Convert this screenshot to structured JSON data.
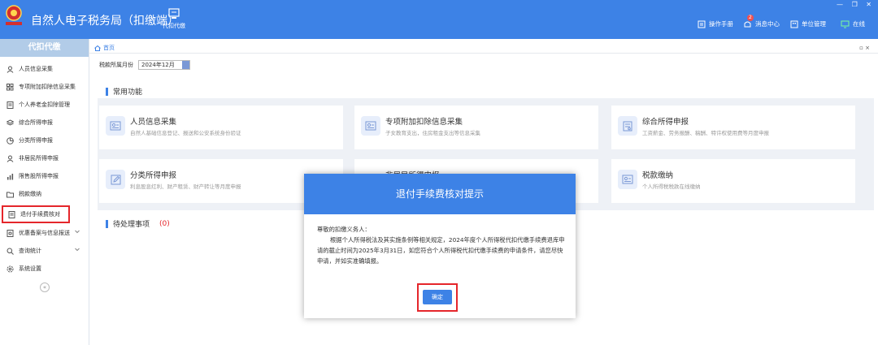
{
  "header": {
    "title": "自然人电子税务局（扣缴端）",
    "logo_label": "中国税务",
    "tab_label": "代扣代缴",
    "window_controls": "— ❐ ✕",
    "manual": "操作手册",
    "messages": "消息中心",
    "message_count": "2",
    "unit_manage": "单位管理",
    "online": "在线"
  },
  "sidebar": {
    "heading": "代扣代缴",
    "items": [
      {
        "label": "人员信息采集",
        "icon": "person-icon"
      },
      {
        "label": "专项附加扣除信息采集",
        "icon": "grid-icon"
      },
      {
        "label": "个人养老金扣除管理",
        "icon": "doc-icon"
      },
      {
        "label": "综合所得申报",
        "icon": "stack-icon"
      },
      {
        "label": "分类所得申报",
        "icon": "pie-icon"
      },
      {
        "label": "非居民所得申报",
        "icon": "person-icon"
      },
      {
        "label": "限售股所得申报",
        "icon": "bar-chart-icon"
      },
      {
        "label": "税款缴纳",
        "icon": "folder-icon"
      },
      {
        "label": "退付手续费核对",
        "icon": "doc-icon"
      },
      {
        "label": "优惠备案与信息报送",
        "icon": "doc-icon"
      },
      {
        "label": "查询统计",
        "icon": "search-icon"
      },
      {
        "label": "系统设置",
        "icon": "gear-icon"
      }
    ],
    "collapse": "«"
  },
  "main": {
    "breadcrumb": "首页",
    "pin": "▫ ×",
    "period_label": "税款所属月份",
    "period_value": "2024年12月",
    "common_title": "常用功能",
    "cards": [
      {
        "title": "人员信息采集",
        "desc": "自然人基础信息登记、报送和公安系统身份验证"
      },
      {
        "title": "专项附加扣除信息采集",
        "desc": "子女教育支出，住房租金支出等信息采集"
      },
      {
        "title": "综合所得申报",
        "desc": "工资薪金、劳务报酬、稿酬、特许权使用费等月度申报"
      },
      {
        "title": "分类所得申报",
        "desc": "利息股息红利、财产租赁、财产转让等月度申报"
      },
      {
        "title": "非居民所得申报",
        "desc": ""
      },
      {
        "title": "税款缴纳",
        "desc": "个人所得税税款在线缴纳"
      }
    ],
    "todo_title": "待处理事项",
    "todo_count": "(0)"
  },
  "modal": {
    "title": "退付手续费核对提示",
    "greeting": "尊敬的扣缴义务人：",
    "body": "根据个人所得税法及其实施条例等相关规定，2024年度个人所得税代扣代缴手续费退库申请的截止时间为2025年3月31日，如您符合个人所得税代扣代缴手续费的申请条件，请您尽快申请，并如实准确填报。",
    "ok": "确定"
  },
  "colors": {
    "brand": "#3d82e6",
    "highlight": "#e5262b"
  }
}
